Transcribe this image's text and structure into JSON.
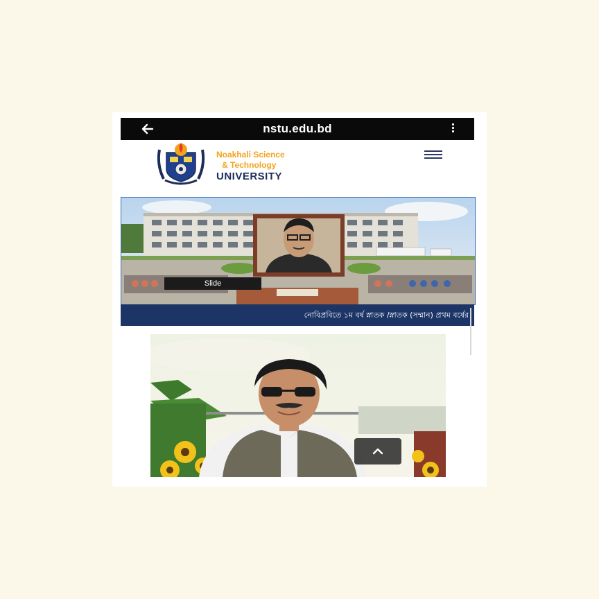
{
  "browser": {
    "url": "nstu.edu.bd",
    "back_icon": "arrow-left-icon",
    "menu_icon": "kebab-menu-icon"
  },
  "header": {
    "university_line1": "Noakhali Science",
    "university_line2": "& Technology",
    "university_line3": "UNIVERSITY",
    "menu_icon": "hamburger-icon"
  },
  "slider": {
    "caption": "Slide"
  },
  "notice": {
    "text": "নোবিপ্রবিতে ১ম বর্ষ স্নাতক /স্নাতক (সম্মান) প্রথম বর্ষের"
  },
  "scroll_top": {
    "icon": "chevron-up-icon"
  },
  "colors": {
    "page_background": "#fbf8e9",
    "url_bar": "#0a0a0a",
    "brand_orange": "#f2a31a",
    "brand_navy": "#1f2d5a",
    "notice_bar": "#1c3566"
  }
}
